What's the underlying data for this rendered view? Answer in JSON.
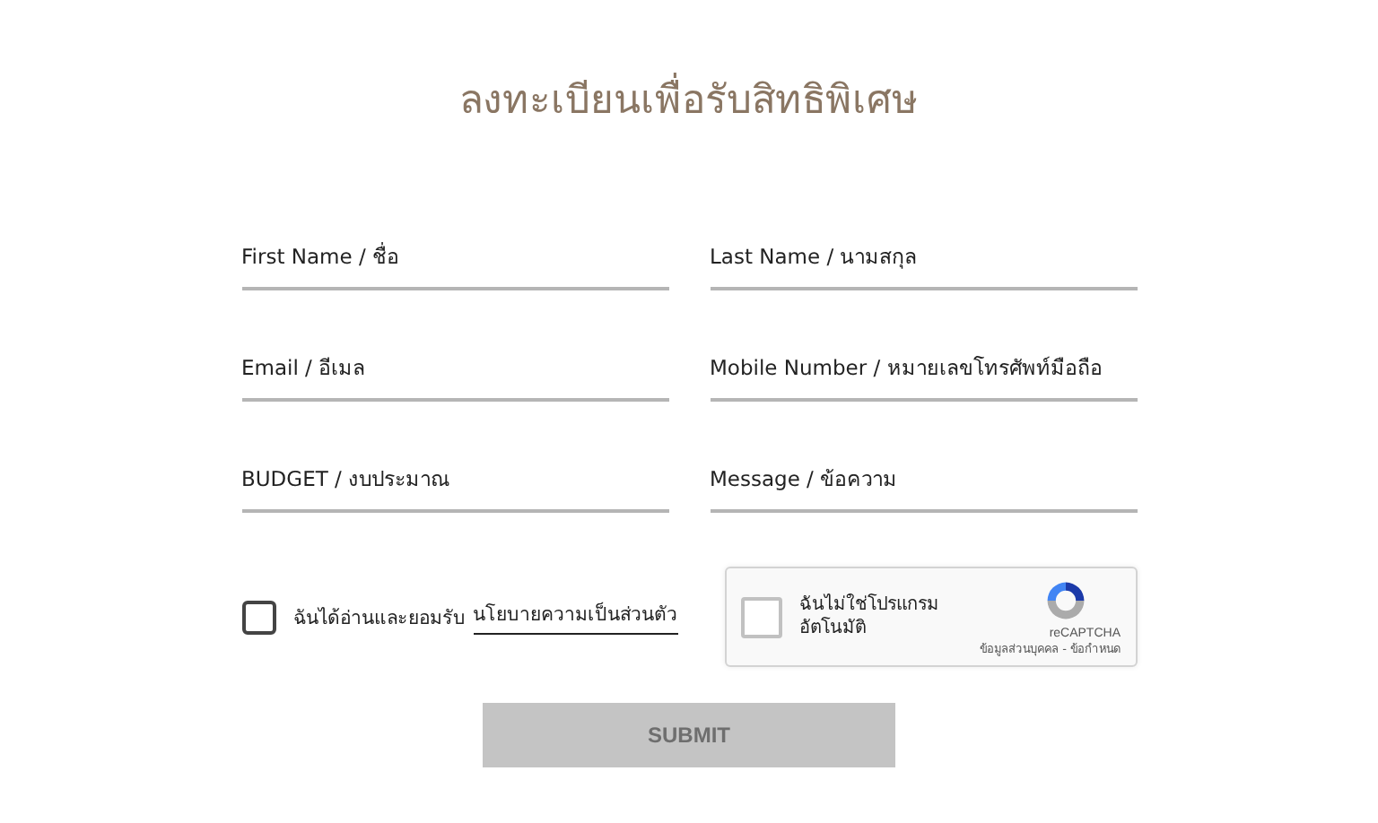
{
  "title": "ลงทะเบียนเพื่อรับสิทธิพิเศษ",
  "fields": [
    {
      "placeholder": "First Name / ชื่อ"
    },
    {
      "placeholder": "Last Name / นามสกุล"
    },
    {
      "placeholder": "Email / อีเมล"
    },
    {
      "placeholder": "Mobile Number / หมายเลขโทรศัพท์มือถือ"
    },
    {
      "placeholder": "BUDGET / งบประมาณ"
    },
    {
      "placeholder": "Message / ข้อความ"
    }
  ],
  "consent": {
    "checked": false,
    "text": "ฉันได้อ่านและยอมรับ",
    "link": "นโยบายความเป็นส่วนตัว"
  },
  "captcha": {
    "checked": false,
    "label": "ฉันไม่ใช่โปรแกรมอัตโนมัติ",
    "brand": "reCAPTCHA",
    "footer": "ข้อมูลส่วนบุคคล - ข้อกำหนด"
  },
  "submit": {
    "label": "SUBMIT",
    "disabled": true
  }
}
